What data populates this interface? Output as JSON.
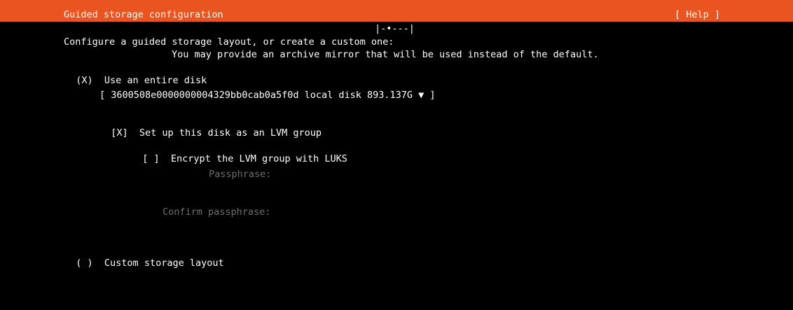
{
  "header": {
    "title": "Guided storage configuration",
    "help_label": "[ Help ]",
    "bg_color": "#e95420"
  },
  "progress": {
    "indicator": "|-•---|"
  },
  "main": {
    "intro": "Configure a guided storage layout, or create a custom one:",
    "mirror_note": "You may provide an archive mirror that will be used instead of the default.",
    "option_entire_disk": {
      "marker": "(X)",
      "label": "Use an entire disk"
    },
    "disk_select": {
      "text": "[ 3600508e0000000004329bb0cab0a5f0d local disk 893.137G ▼ ]"
    },
    "lvm_checkbox": {
      "marker": "[X]",
      "label": "Set up this disk as an LVM group"
    },
    "luks_checkbox": {
      "marker": "[ ]",
      "label": "Encrypt the LVM group with LUKS"
    },
    "passphrase_label": "Passphrase:",
    "confirm_passphrase_label": "Confirm passphrase:",
    "option_custom": {
      "marker": "( )",
      "label": "Custom storage layout"
    }
  }
}
